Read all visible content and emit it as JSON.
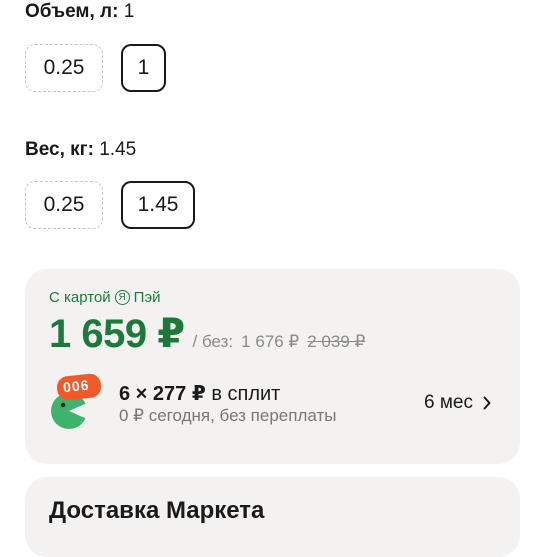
{
  "volume": {
    "label": "Объем, л:",
    "value": "1",
    "options": [
      "0.25",
      "1"
    ],
    "selected": "1"
  },
  "weight": {
    "label": "Вес, кг:",
    "value": "1.45",
    "options": [
      "0.25",
      "1.45"
    ],
    "selected": "1.45"
  },
  "pay_card": {
    "label_prefix": "С картой",
    "logo_letter": "Я",
    "label_suffix": "Пэй",
    "price": "1 659 ₽",
    "without_prefix": "/ без:",
    "without_price": "1 676 ₽",
    "old_price": "2 039 ₽",
    "split_icon_badge": "006",
    "split_amount": "6 × 277 ₽",
    "split_text": "в сплит",
    "split_sub": "0 ₽ сегодня, без переплаты",
    "months": "6 мес"
  },
  "delivery": {
    "title": "Доставка Маркета"
  },
  "colors": {
    "green": "#1b7a3a",
    "split_orange": "#f05a28",
    "split_green": "#3db36b",
    "card_bg": "#f3f2f1"
  }
}
